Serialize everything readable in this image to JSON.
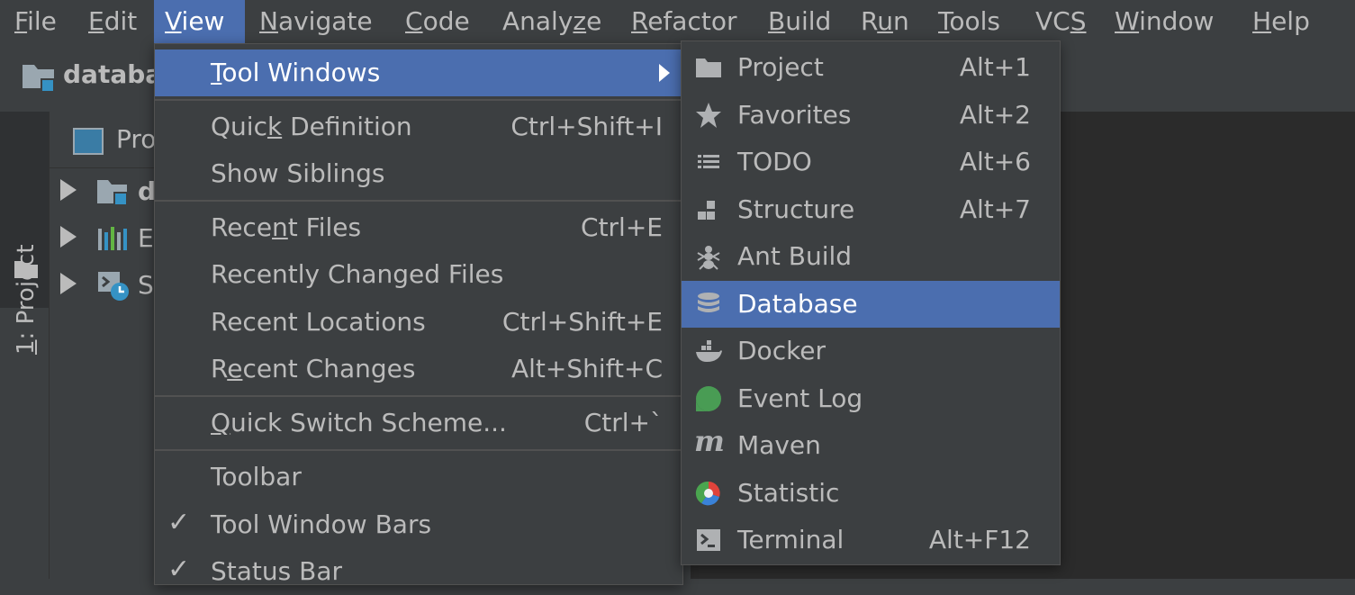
{
  "menubar": {
    "items": [
      {
        "pre": "",
        "u": "F",
        "post": "ile"
      },
      {
        "pre": "",
        "u": "E",
        "post": "dit"
      },
      {
        "pre": "",
        "u": "V",
        "post": "iew"
      },
      {
        "pre": "",
        "u": "N",
        "post": "avigate"
      },
      {
        "pre": "",
        "u": "C",
        "post": "ode"
      },
      {
        "pre": "Analy",
        "u": "z",
        "post": "e"
      },
      {
        "pre": "",
        "u": "R",
        "post": "efactor"
      },
      {
        "pre": "",
        "u": "B",
        "post": "uild"
      },
      {
        "pre": "R",
        "u": "u",
        "post": "n"
      },
      {
        "pre": "",
        "u": "T",
        "post": "ools"
      },
      {
        "pre": "VC",
        "u": "S",
        "post": ""
      },
      {
        "pre": "",
        "u": "W",
        "post": "indow"
      },
      {
        "pre": "",
        "u": "H",
        "post": "elp"
      }
    ]
  },
  "navbar": {
    "crumb": "databa"
  },
  "stripe": {
    "tab_label_u": "1",
    "tab_label_rest": ": Project"
  },
  "panel": {
    "header": "Pro",
    "rows": [
      {
        "text": "d"
      },
      {
        "text": "E"
      },
      {
        "text": "S"
      }
    ]
  },
  "view_menu": {
    "tool_windows": {
      "pre": "",
      "u": "T",
      "post": "ool Windows"
    },
    "quick_definition": {
      "pre": "Quic",
      "u": "k",
      "post": " Definition",
      "shortcut": "Ctrl+Shift+I"
    },
    "show_siblings": {
      "label": "Show Siblings"
    },
    "recent_files": {
      "pre": "Rece",
      "u": "n",
      "post": "t Files",
      "shortcut": "Ctrl+E"
    },
    "recently_changed": {
      "label": "Recently Changed Files"
    },
    "recent_locations": {
      "label": "Recent Locations",
      "shortcut": "Ctrl+Shift+E"
    },
    "recent_changes": {
      "pre": "R",
      "u": "e",
      "post": "cent Changes",
      "shortcut": "Alt+Shift+C"
    },
    "quick_switch": {
      "pre": "",
      "u": "Q",
      "post": "uick Switch Scheme...",
      "shortcut": "Ctrl+`"
    },
    "toolbar": {
      "label": "Toolbar"
    },
    "tool_window_bars": {
      "label": "Tool Window Bars",
      "check": "✓"
    },
    "status_bar": {
      "label": "Status Bar",
      "check": "✓"
    }
  },
  "tool_windows_menu": {
    "items": [
      {
        "label": "Project",
        "shortcut": "Alt+1",
        "icon": "folder-icon"
      },
      {
        "label": "Favorites",
        "shortcut": "Alt+2",
        "icon": "star-icon"
      },
      {
        "label": "TODO",
        "shortcut": "Alt+6",
        "icon": "list-icon"
      },
      {
        "label": "Structure",
        "shortcut": "Alt+7",
        "icon": "structure-icon"
      },
      {
        "label": "Ant Build",
        "shortcut": "",
        "icon": "ant-icon"
      },
      {
        "label": "Database",
        "shortcut": "",
        "icon": "database-icon"
      },
      {
        "label": "Docker",
        "shortcut": "",
        "icon": "docker-icon"
      },
      {
        "label": "Event Log",
        "shortcut": "",
        "icon": "event-log-icon"
      },
      {
        "label": "Maven",
        "shortcut": "",
        "icon": "maven-icon"
      },
      {
        "label": "Statistic",
        "shortcut": "",
        "icon": "statistic-icon"
      },
      {
        "label": "Terminal",
        "shortcut": "Alt+F12",
        "icon": "terminal-icon"
      }
    ],
    "selected": "Database"
  },
  "colors": {
    "highlight": "#4b6eaf",
    "background": "#3c3f41",
    "editor": "#2b2b2b",
    "text": "#bbbbbb"
  }
}
